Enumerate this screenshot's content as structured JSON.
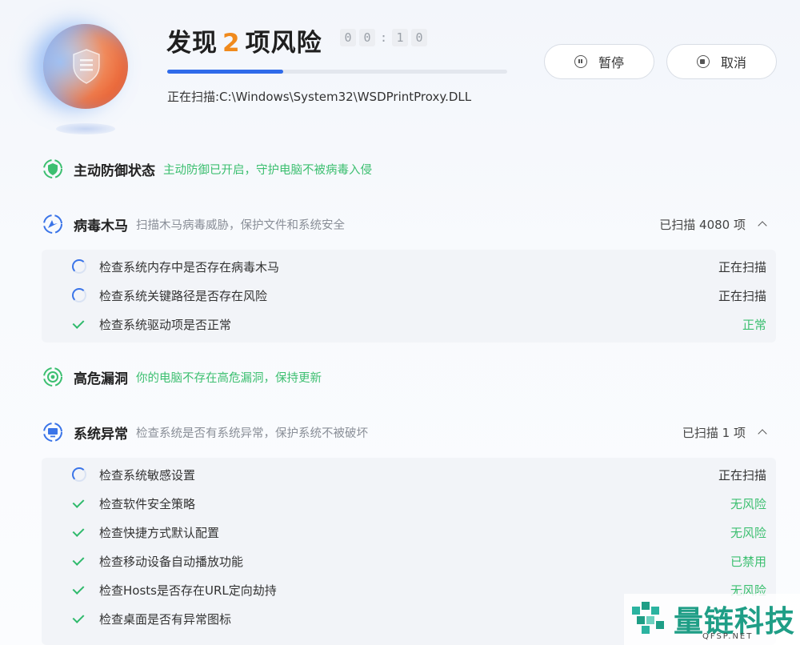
{
  "header": {
    "headline_prefix": "发现",
    "risk_count": "2",
    "headline_suffix": "项风险",
    "timer_digits": [
      "0",
      "0",
      "1",
      "0"
    ],
    "timer_separator": ":",
    "progress_fraction": 0.34,
    "scan_path": "正在扫描:C:\\Windows\\System32\\WSDPrintProxy.DLL",
    "pause_label": "暂停",
    "cancel_label": "取消"
  },
  "sections": {
    "defense": {
      "title": "主动防御状态",
      "desc": "主动防御已开启，守护电脑不被病毒入侵"
    },
    "virus": {
      "title": "病毒木马",
      "desc": "扫描木马病毒威胁，保护文件和系统安全",
      "count": "已扫描 4080 项",
      "items": [
        {
          "label": "检查系统内存中是否存在病毒木马",
          "status": "正在扫描",
          "state": "scanning"
        },
        {
          "label": "检查系统关键路径是否存在风险",
          "status": "正在扫描",
          "state": "scanning"
        },
        {
          "label": "检查系统驱动项是否正常",
          "status": "正常",
          "state": "ok"
        }
      ]
    },
    "vuln": {
      "title": "高危漏洞",
      "desc": "你的电脑不存在高危漏洞，保持更新"
    },
    "system": {
      "title": "系统异常",
      "desc": "检查系统是否有系统异常，保护系统不被破坏",
      "count": "已扫描 1 项",
      "items": [
        {
          "label": "检查系统敏感设置",
          "status": "正在扫描",
          "state": "scanning"
        },
        {
          "label": "检查软件安全策略",
          "status": "无风险",
          "state": "ok"
        },
        {
          "label": "检查快捷方式默认配置",
          "status": "无风险",
          "state": "ok"
        },
        {
          "label": "检查移动设备自动播放功能",
          "status": "已禁用",
          "state": "ok"
        },
        {
          "label": "检查Hosts是否存在URL定向劫持",
          "status": "无风险",
          "state": "ok"
        },
        {
          "label": "检查桌面是否有异常图标",
          "status": "",
          "state": "ok"
        }
      ]
    }
  },
  "watermark": {
    "brand": "量链科技",
    "site": "QFSP.NET"
  },
  "colors": {
    "accent": "#2f6bea",
    "risk": "#f08a1c",
    "ok": "#3cbf70"
  }
}
